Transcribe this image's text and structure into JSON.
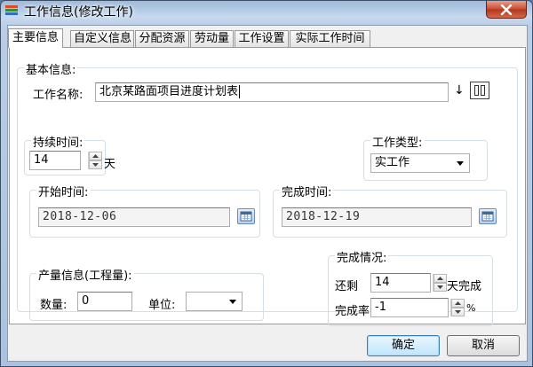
{
  "window": {
    "title": "工作信息(修改工作)"
  },
  "tabs": [
    {
      "label": "主要信息",
      "active": true
    },
    {
      "label": "自定义信息",
      "active": false
    },
    {
      "label": "分配资源",
      "active": false
    },
    {
      "label": "劳动量",
      "active": false
    },
    {
      "label": "工作设置",
      "active": false
    },
    {
      "label": "实际工作时间",
      "active": false
    }
  ],
  "basic": {
    "legend": "基本信息:",
    "name_label": "工作名称:",
    "name_value": "北京某路面项目进度计划表",
    "duration_legend": "持续时间:",
    "duration_value": "14",
    "duration_unit": "天",
    "type_legend": "工作类型:",
    "type_value": "实工作",
    "start_legend": "开始时间:",
    "start_value": "2018-12-06",
    "finish_legend": "完成时间:",
    "finish_value": "2018-12-19"
  },
  "output": {
    "legend": "产量信息(工程量):",
    "qty_label": "数量:",
    "qty_value": "0",
    "unit_label": "单位:",
    "unit_value": ""
  },
  "completion": {
    "legend": "完成情况:",
    "remain_label": "还剩",
    "remain_value": "14",
    "remain_suffix": "天完成",
    "rate_label": "完成率",
    "rate_value": "-1",
    "rate_unit": "%"
  },
  "buttons": {
    "ok": "确定",
    "cancel": "取消"
  },
  "colors": {
    "title_bar": "#b9cde6",
    "close_button": "#c74a2f",
    "default_button": "#bee6fd"
  }
}
